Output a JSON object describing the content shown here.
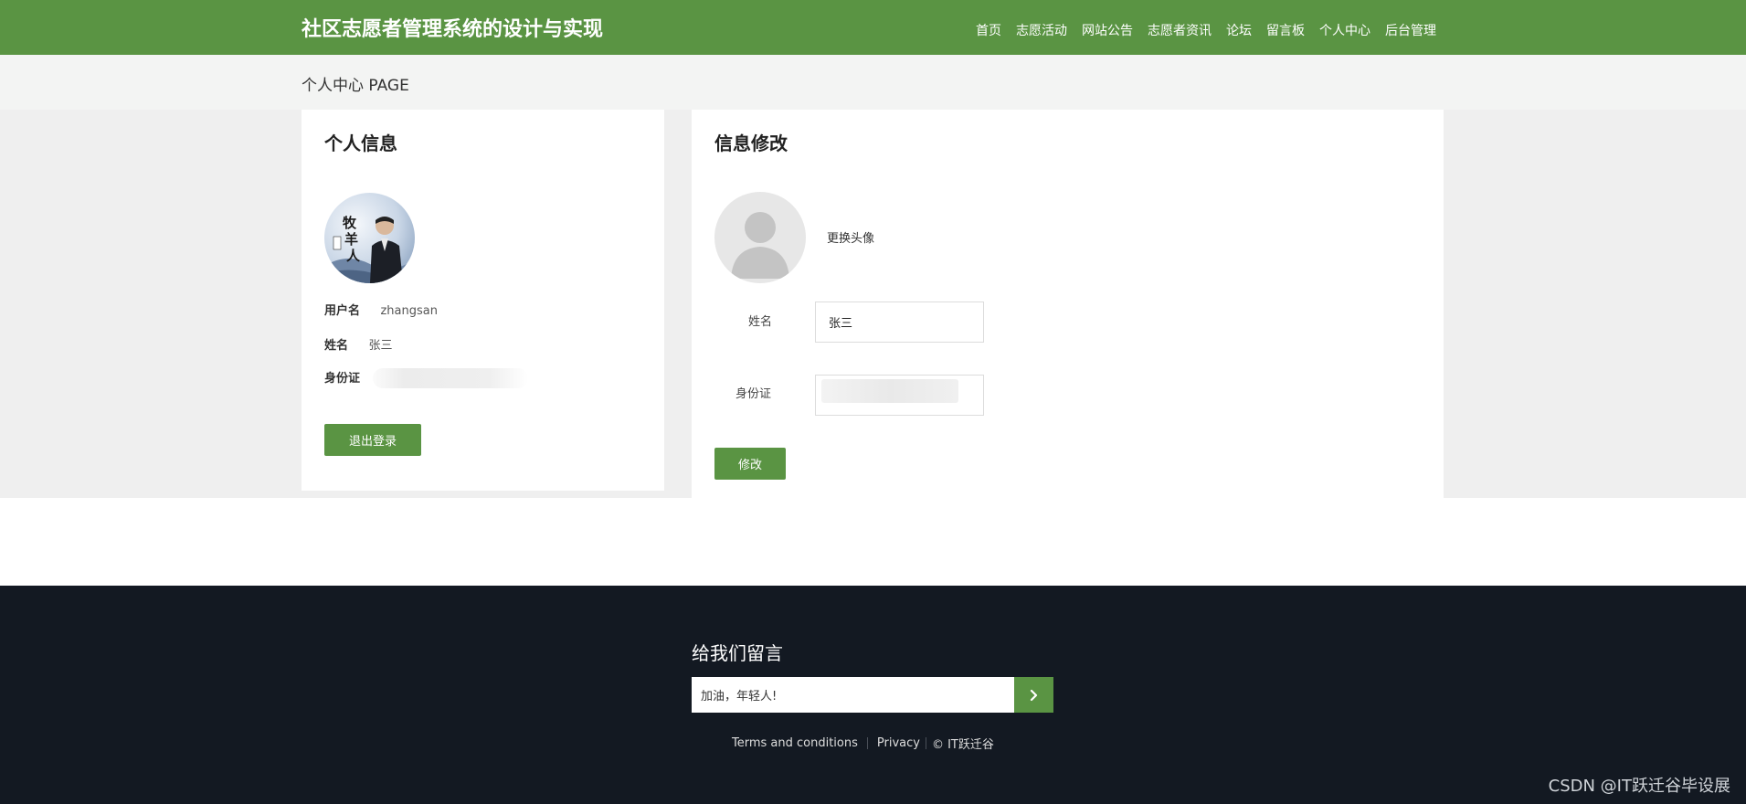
{
  "header": {
    "title": "社区志愿者管理系统的设计与实现",
    "nav": [
      "首页",
      "志愿活动",
      "网站公告",
      "志愿者资讯",
      "论坛",
      "留言板",
      "个人中心",
      "后台管理"
    ]
  },
  "breadcrumb": "个人中心 PAGE",
  "profile": {
    "title": "个人信息",
    "username_label": "用户名",
    "username": "zhangsan",
    "name_label": "姓名",
    "name": "张三",
    "id_label": "身份证",
    "logout_label": "退出登录"
  },
  "edit": {
    "title": "信息修改",
    "change_avatar": "更换头像",
    "name_label": "姓名",
    "name_value": "张三",
    "id_label": "身份证",
    "submit_label": "修改"
  },
  "footer": {
    "title": "给我们留言",
    "message_value": "加油，年轻人!",
    "links": [
      "Terms and conditions",
      "Privacy",
      "© IT跃迁谷"
    ],
    "watermark": "CSDN @IT跃迁谷毕设展"
  },
  "colors": {
    "brand_green": "#5a9443",
    "footer_bg": "#131922",
    "band_gray": "#f3f4f3"
  },
  "icons": {
    "submit": "chevron-right-icon",
    "default_avatar": "user-silhouette-icon"
  }
}
